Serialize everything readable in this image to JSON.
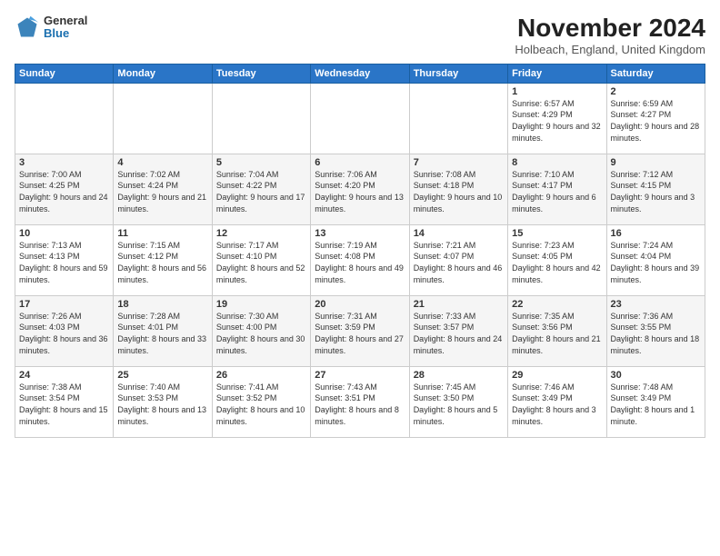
{
  "logo": {
    "general": "General",
    "blue": "Blue"
  },
  "title": {
    "month": "November 2024",
    "location": "Holbeach, England, United Kingdom"
  },
  "headers": [
    "Sunday",
    "Monday",
    "Tuesday",
    "Wednesday",
    "Thursday",
    "Friday",
    "Saturday"
  ],
  "weeks": [
    [
      {
        "day": "",
        "info": ""
      },
      {
        "day": "",
        "info": ""
      },
      {
        "day": "",
        "info": ""
      },
      {
        "day": "",
        "info": ""
      },
      {
        "day": "",
        "info": ""
      },
      {
        "day": "1",
        "info": "Sunrise: 6:57 AM\nSunset: 4:29 PM\nDaylight: 9 hours and 32 minutes."
      },
      {
        "day": "2",
        "info": "Sunrise: 6:59 AM\nSunset: 4:27 PM\nDaylight: 9 hours and 28 minutes."
      }
    ],
    [
      {
        "day": "3",
        "info": "Sunrise: 7:00 AM\nSunset: 4:25 PM\nDaylight: 9 hours and 24 minutes."
      },
      {
        "day": "4",
        "info": "Sunrise: 7:02 AM\nSunset: 4:24 PM\nDaylight: 9 hours and 21 minutes."
      },
      {
        "day": "5",
        "info": "Sunrise: 7:04 AM\nSunset: 4:22 PM\nDaylight: 9 hours and 17 minutes."
      },
      {
        "day": "6",
        "info": "Sunrise: 7:06 AM\nSunset: 4:20 PM\nDaylight: 9 hours and 13 minutes."
      },
      {
        "day": "7",
        "info": "Sunrise: 7:08 AM\nSunset: 4:18 PM\nDaylight: 9 hours and 10 minutes."
      },
      {
        "day": "8",
        "info": "Sunrise: 7:10 AM\nSunset: 4:17 PM\nDaylight: 9 hours and 6 minutes."
      },
      {
        "day": "9",
        "info": "Sunrise: 7:12 AM\nSunset: 4:15 PM\nDaylight: 9 hours and 3 minutes."
      }
    ],
    [
      {
        "day": "10",
        "info": "Sunrise: 7:13 AM\nSunset: 4:13 PM\nDaylight: 8 hours and 59 minutes."
      },
      {
        "day": "11",
        "info": "Sunrise: 7:15 AM\nSunset: 4:12 PM\nDaylight: 8 hours and 56 minutes."
      },
      {
        "day": "12",
        "info": "Sunrise: 7:17 AM\nSunset: 4:10 PM\nDaylight: 8 hours and 52 minutes."
      },
      {
        "day": "13",
        "info": "Sunrise: 7:19 AM\nSunset: 4:08 PM\nDaylight: 8 hours and 49 minutes."
      },
      {
        "day": "14",
        "info": "Sunrise: 7:21 AM\nSunset: 4:07 PM\nDaylight: 8 hours and 46 minutes."
      },
      {
        "day": "15",
        "info": "Sunrise: 7:23 AM\nSunset: 4:05 PM\nDaylight: 8 hours and 42 minutes."
      },
      {
        "day": "16",
        "info": "Sunrise: 7:24 AM\nSunset: 4:04 PM\nDaylight: 8 hours and 39 minutes."
      }
    ],
    [
      {
        "day": "17",
        "info": "Sunrise: 7:26 AM\nSunset: 4:03 PM\nDaylight: 8 hours and 36 minutes."
      },
      {
        "day": "18",
        "info": "Sunrise: 7:28 AM\nSunset: 4:01 PM\nDaylight: 8 hours and 33 minutes."
      },
      {
        "day": "19",
        "info": "Sunrise: 7:30 AM\nSunset: 4:00 PM\nDaylight: 8 hours and 30 minutes."
      },
      {
        "day": "20",
        "info": "Sunrise: 7:31 AM\nSunset: 3:59 PM\nDaylight: 8 hours and 27 minutes."
      },
      {
        "day": "21",
        "info": "Sunrise: 7:33 AM\nSunset: 3:57 PM\nDaylight: 8 hours and 24 minutes."
      },
      {
        "day": "22",
        "info": "Sunrise: 7:35 AM\nSunset: 3:56 PM\nDaylight: 8 hours and 21 minutes."
      },
      {
        "day": "23",
        "info": "Sunrise: 7:36 AM\nSunset: 3:55 PM\nDaylight: 8 hours and 18 minutes."
      }
    ],
    [
      {
        "day": "24",
        "info": "Sunrise: 7:38 AM\nSunset: 3:54 PM\nDaylight: 8 hours and 15 minutes."
      },
      {
        "day": "25",
        "info": "Sunrise: 7:40 AM\nSunset: 3:53 PM\nDaylight: 8 hours and 13 minutes."
      },
      {
        "day": "26",
        "info": "Sunrise: 7:41 AM\nSunset: 3:52 PM\nDaylight: 8 hours and 10 minutes."
      },
      {
        "day": "27",
        "info": "Sunrise: 7:43 AM\nSunset: 3:51 PM\nDaylight: 8 hours and 8 minutes."
      },
      {
        "day": "28",
        "info": "Sunrise: 7:45 AM\nSunset: 3:50 PM\nDaylight: 8 hours and 5 minutes."
      },
      {
        "day": "29",
        "info": "Sunrise: 7:46 AM\nSunset: 3:49 PM\nDaylight: 8 hours and 3 minutes."
      },
      {
        "day": "30",
        "info": "Sunrise: 7:48 AM\nSunset: 3:49 PM\nDaylight: 8 hours and 1 minute."
      }
    ]
  ]
}
